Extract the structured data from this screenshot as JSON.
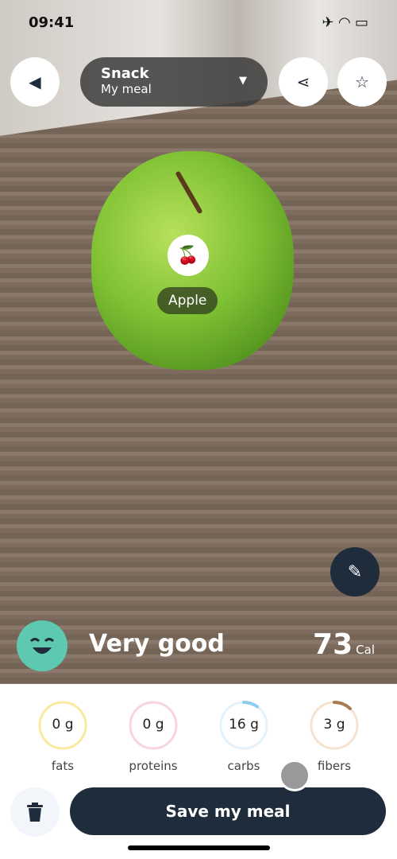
{
  "status_bar": {
    "time": "09:41",
    "icons": [
      "airplane-icon",
      "wifi-icon",
      "battery-icon"
    ]
  },
  "header": {
    "meal_type": "Snack",
    "meal_name": "My meal"
  },
  "food": {
    "label": "Apple",
    "icon": "fruit-icon"
  },
  "summary": {
    "rating": "Very good",
    "calories": "73",
    "calories_unit": "Cal"
  },
  "macros": [
    {
      "value": "0 g",
      "label": "fats",
      "color": "#fbe9a0",
      "progress": 0
    },
    {
      "value": "0 g",
      "label": "proteins",
      "color": "#f9d4dc",
      "progress": 0
    },
    {
      "value": "16 g",
      "label": "carbs",
      "color": "#8fcdf0",
      "track": "#e3f2fb",
      "progress": 0.1
    },
    {
      "value": "3 g",
      "label": "fibers",
      "color": "#a67c52",
      "track": "#f5e3d2",
      "progress": 0.12
    }
  ],
  "actions": {
    "save": "Save my meal"
  }
}
